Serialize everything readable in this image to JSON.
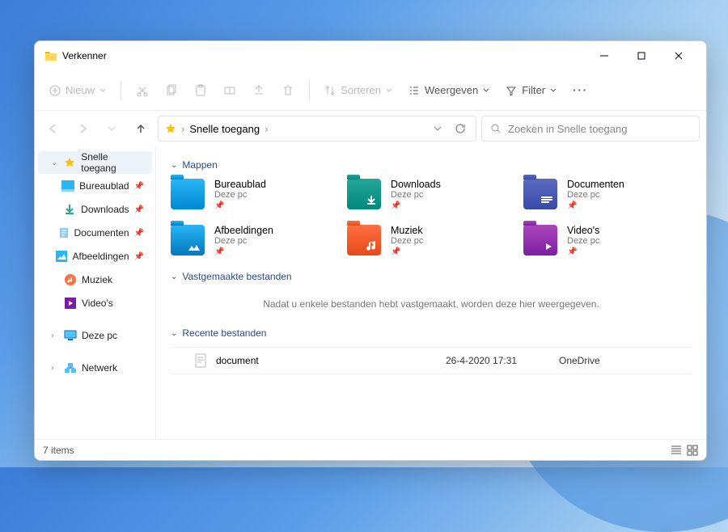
{
  "window": {
    "title": "Verkenner"
  },
  "toolbar": {
    "new": "Nieuw",
    "sort": "Sorteren",
    "view": "Weergeven",
    "filter": "Filter"
  },
  "breadcrumb": {
    "current": "Snelle toegang"
  },
  "search": {
    "placeholder": "Zoeken in Snelle toegang"
  },
  "sidebar": {
    "items": [
      {
        "label": "Snelle toegang",
        "selected": true,
        "expandable": true,
        "star": true
      },
      {
        "label": "Bureaublad",
        "pinned": true,
        "icon": "desktop"
      },
      {
        "label": "Downloads",
        "pinned": true,
        "icon": "downloads"
      },
      {
        "label": "Documenten",
        "pinned": true,
        "icon": "documents"
      },
      {
        "label": "Afbeeldingen",
        "pinned": true,
        "icon": "pictures"
      },
      {
        "label": "Muziek",
        "icon": "music"
      },
      {
        "label": "Video's",
        "icon": "videos"
      },
      {
        "label": "Deze pc",
        "expandable": true,
        "top": true,
        "icon": "pc"
      },
      {
        "label": "Netwerk",
        "expandable": true,
        "top": true,
        "icon": "network"
      }
    ]
  },
  "sections": {
    "folders": "Mappen",
    "pinned": "Vastgemaakte bestanden",
    "recent": "Recente bestanden"
  },
  "folders": [
    {
      "name": "Bureaublad",
      "loc": "Deze pc",
      "color": "blue"
    },
    {
      "name": "Downloads",
      "loc": "Deze pc",
      "color": "green"
    },
    {
      "name": "Documenten",
      "loc": "Deze pc",
      "color": "teal"
    },
    {
      "name": "Afbeeldingen",
      "loc": "Deze pc",
      "color": "cyan"
    },
    {
      "name": "Muziek",
      "loc": "Deze pc",
      "color": "orange"
    },
    {
      "name": "Video's",
      "loc": "Deze pc",
      "color": "purple"
    }
  ],
  "pinned_empty": "Nadat u enkele bestanden hebt vastgemaakt, worden deze hier weergegeven.",
  "recent": [
    {
      "name": "document",
      "date": "26-4-2020 17:31",
      "source": "OneDrive"
    }
  ],
  "status": {
    "count": "7 items"
  }
}
